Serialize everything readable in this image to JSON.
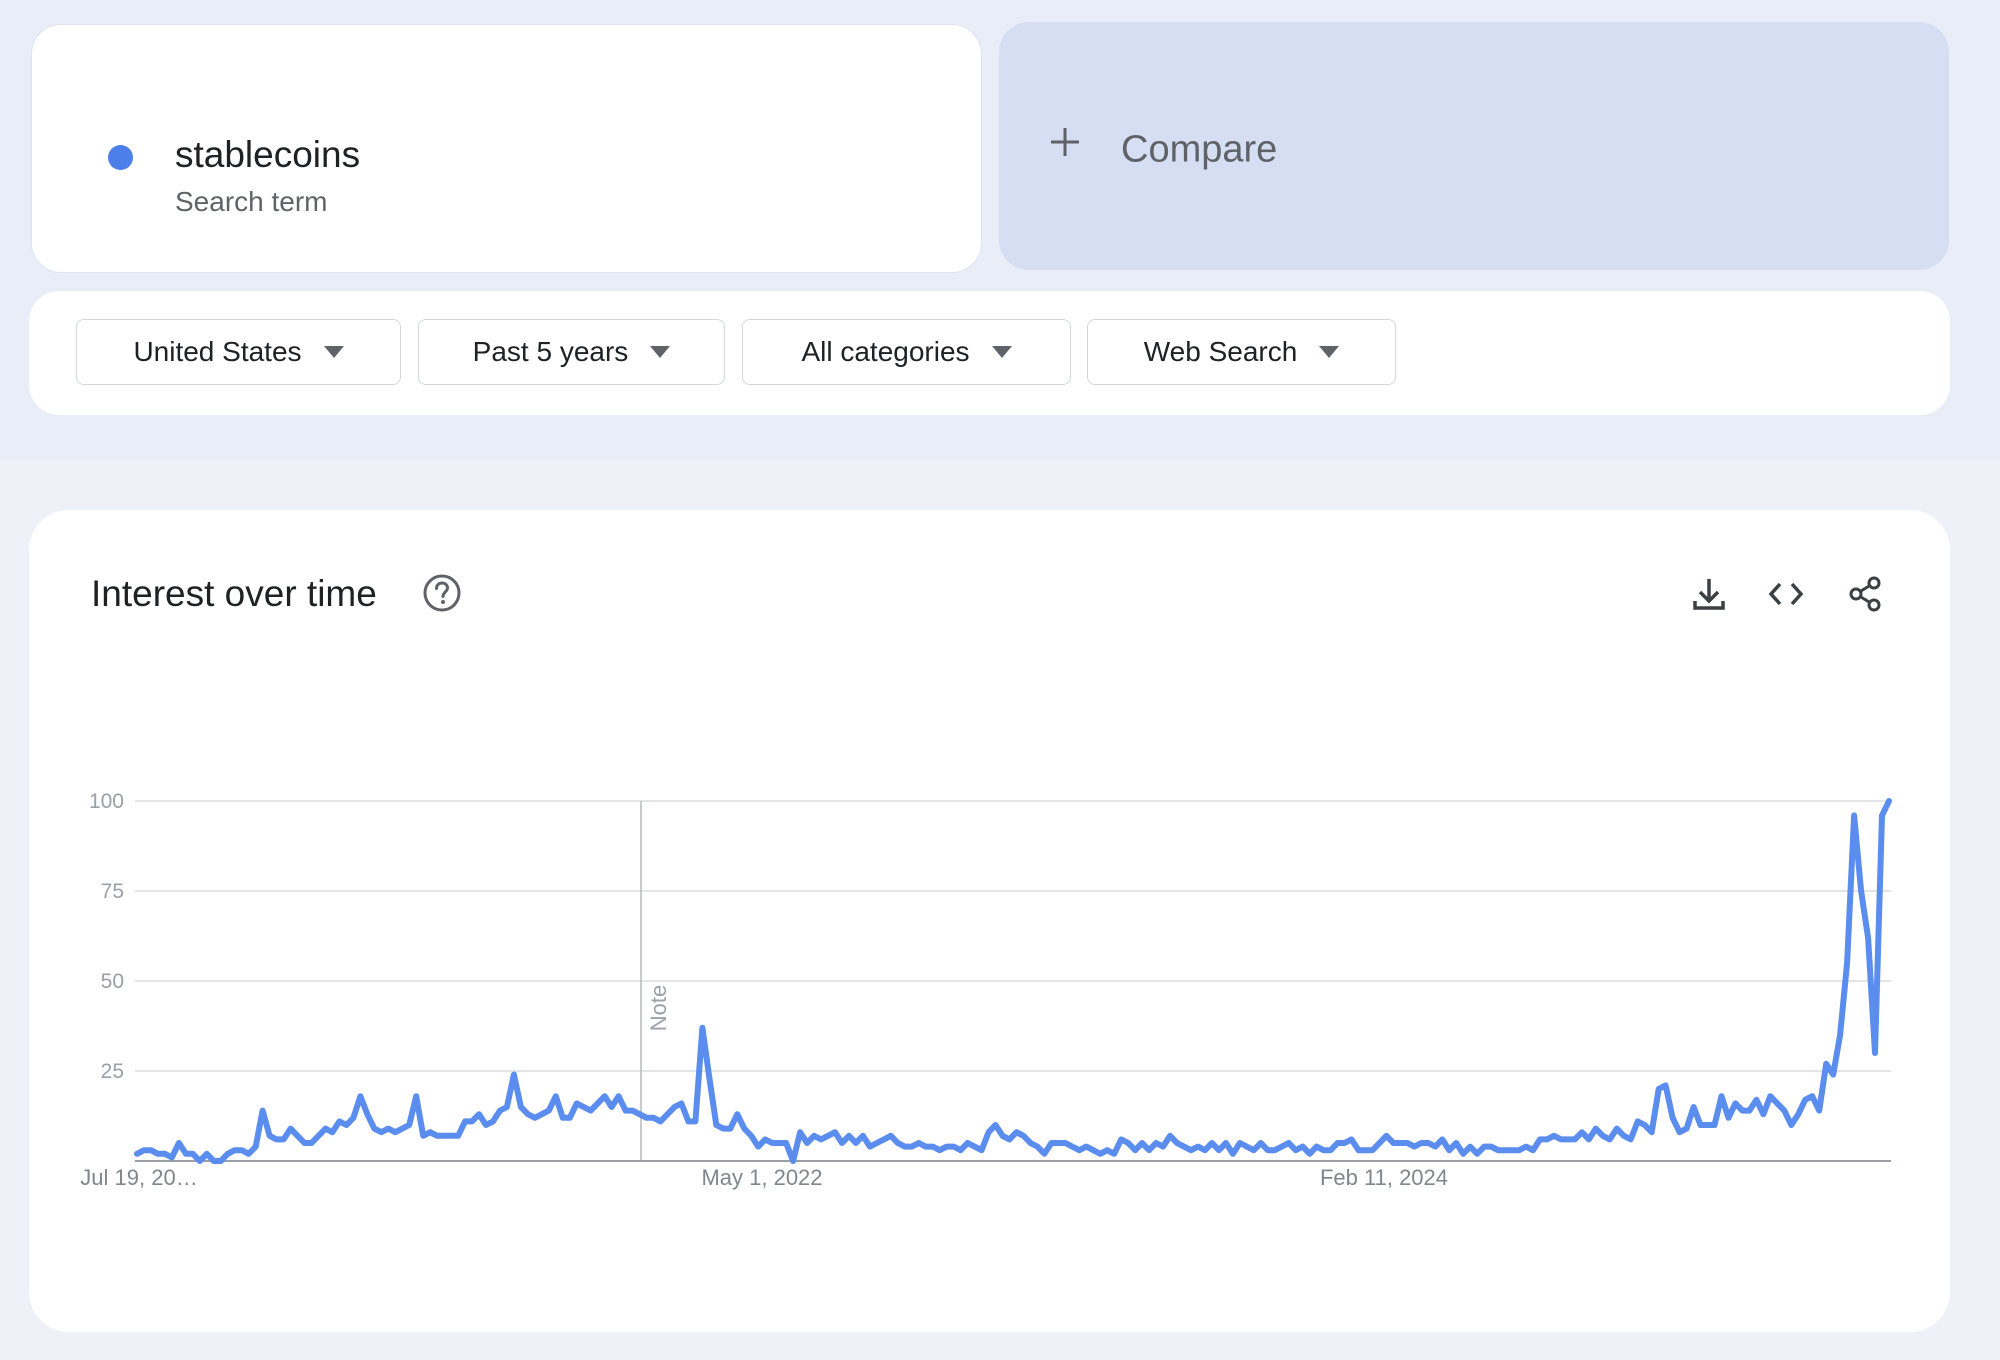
{
  "search_term": {
    "name": "stablecoins",
    "type": "Search term",
    "color": "#4c7fe9"
  },
  "compare": {
    "label": "Compare",
    "icon": "plus-icon"
  },
  "filters": [
    {
      "label": "United States",
      "icon": "dropdown-caret-icon"
    },
    {
      "label": "Past 5 years",
      "icon": "dropdown-caret-icon"
    },
    {
      "label": "All categories",
      "icon": "dropdown-caret-icon"
    },
    {
      "label": "Web Search",
      "icon": "dropdown-caret-icon"
    }
  ],
  "panel": {
    "title": "Interest over time",
    "help_icon": "help-circle-icon",
    "actions": [
      "download-icon",
      "embed-code-icon",
      "share-icon"
    ]
  },
  "chart_data": {
    "type": "line",
    "title": "",
    "xlabel": "",
    "ylabel": "",
    "ylim": [
      0,
      100
    ],
    "yticks": [
      100,
      75,
      50,
      25
    ],
    "xtick_labels": [
      "Jul 19, 20…",
      "May 1, 2022",
      "Feb 11, 2024"
    ],
    "note_label": "Note",
    "grid": true,
    "line_color": "#5b8def",
    "series": [
      {
        "values": [
          2,
          3,
          3,
          2,
          2,
          1,
          5,
          2,
          2,
          0,
          2,
          0,
          0,
          2,
          3,
          3,
          2,
          4,
          14,
          7,
          6,
          6,
          9,
          7,
          5,
          5,
          7,
          9,
          8,
          11,
          10,
          12,
          18,
          13,
          9,
          8,
          9,
          8,
          9,
          10,
          18,
          7,
          8,
          7,
          7,
          7,
          7,
          11,
          11,
          13,
          10,
          11,
          14,
          15,
          24,
          15,
          13,
          12,
          13,
          14,
          18,
          12,
          12,
          16,
          15,
          14,
          16,
          18,
          15,
          18,
          14,
          14,
          13,
          12,
          12,
          11,
          13,
          15,
          16,
          11,
          11,
          37,
          23,
          10,
          9,
          9,
          13,
          9,
          7,
          4,
          6,
          5,
          5,
          5,
          0,
          8,
          5,
          7,
          6,
          7,
          8,
          5,
          7,
          5,
          7,
          4,
          5,
          6,
          7,
          5,
          4,
          4,
          5,
          4,
          4,
          3,
          4,
          4,
          3,
          5,
          4,
          3,
          8,
          10,
          7,
          6,
          8,
          7,
          5,
          4,
          2,
          5,
          5,
          5,
          4,
          3,
          4,
          3,
          2,
          3,
          2,
          6,
          5,
          3,
          5,
          3,
          5,
          4,
          7,
          5,
          4,
          3,
          4,
          3,
          5,
          3,
          5,
          2,
          5,
          4,
          3,
          5,
          3,
          3,
          4,
          5,
          3,
          4,
          2,
          4,
          3,
          3,
          5,
          5,
          6,
          3,
          3,
          3,
          5,
          7,
          5,
          5,
          5,
          4,
          5,
          5,
          4,
          6,
          3,
          5,
          2,
          4,
          2,
          4,
          4,
          3,
          3,
          3,
          3,
          4,
          3,
          6,
          6,
          7,
          6,
          6,
          6,
          8,
          6,
          9,
          7,
          6,
          9,
          7,
          6,
          11,
          10,
          8,
          20,
          21,
          12,
          8,
          9,
          15,
          10,
          10,
          10,
          18,
          12,
          16,
          14,
          14,
          17,
          13,
          18,
          16,
          14,
          10,
          13,
          17,
          18,
          14,
          27,
          24,
          35,
          55,
          96,
          75,
          62,
          30,
          96,
          100
        ]
      }
    ]
  }
}
